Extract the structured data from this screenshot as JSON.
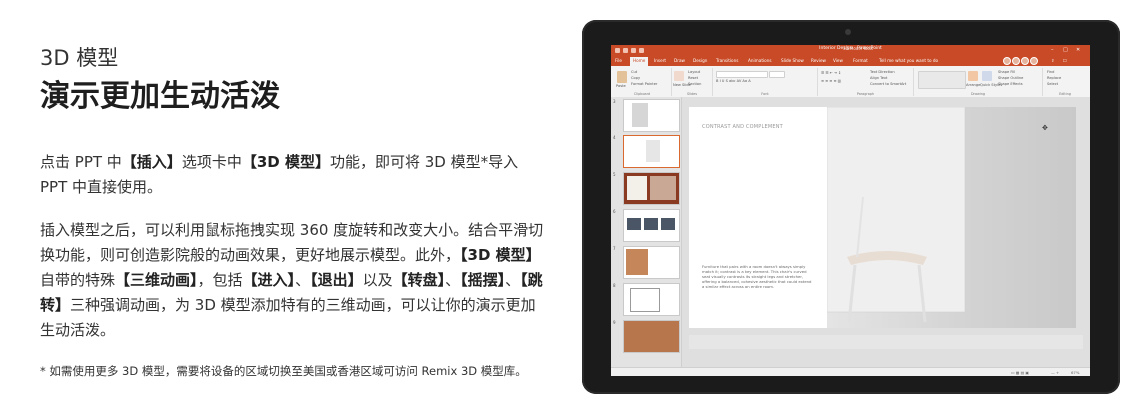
{
  "left": {
    "eyebrow": "3D 模型",
    "headline": "演示更加生动活泼",
    "p1": {
      "t1": "点击 PPT 中",
      "b1": "【插入】",
      "t2": "选项卡中",
      "b2": "【3D 模型】",
      "t3": "功能，即可将 3D 模型*导入 PPT 中直接使用。"
    },
    "p2": {
      "t1": "插入模型之后，可以利用鼠标拖拽实现 360 度旋转和改变大小。结合平滑切换功能，则可创造影院般的动画效果，更好地展示模型。此外，",
      "b1": "【3D 模型】",
      "t2": "自带的特殊",
      "b2": "【三维动画】",
      "t3": "，包括",
      "b3": "【进入】",
      "t4": "、",
      "b4": "【退出】",
      "t5": "以及",
      "b5": "【转盘】",
      "t6": "、",
      "b6": "【摇摆】",
      "t7": "、",
      "b7": "【跳转】",
      "t8": "三种强调动画，为 3D 模型添加特有的三维动画，可以让你的演示更加生动活泼。"
    },
    "footnote": "* 如需使用更多 3D 模型，需要将设备的区域切换至美国或香港区域可访问 Remix 3D 模型库。"
  },
  "device": {
    "window_title": "Interior Design - PowerPoint",
    "context_tab": "3D Model Tools",
    "tabs": [
      "File",
      "Home",
      "Insert",
      "Draw",
      "Design",
      "Transitions",
      "Animations",
      "Slide Show",
      "Review",
      "View",
      "Format"
    ],
    "active_tab": "Home",
    "tell_me": "Tell me what you want to do",
    "ribbon": {
      "clipboard": "Clipboard",
      "slides": "Slides",
      "font": "Font",
      "paragraph": "Paragraph",
      "drawing": "Drawing",
      "editing": "Editing",
      "paste": "Paste",
      "cut": "Cut",
      "copy": "Copy",
      "format_painter": "Format Painter",
      "new_slide": "New Slide",
      "layout": "Layout",
      "reset": "Reset",
      "section": "Section",
      "text_direction": "Text Direction",
      "align_text": "Align Text",
      "convert_smartart": "Convert to SmartArt",
      "arrange": "Arrange",
      "quick_styles": "Quick Styles",
      "shape_fill": "Shape Fill",
      "shape_outline": "Shape Outline",
      "shape_effects": "Shape Effects",
      "find": "Find",
      "replace": "Replace",
      "select": "Select"
    },
    "slide_numbers": [
      "3",
      "4",
      "5",
      "6",
      "7",
      "8",
      "9"
    ],
    "slide": {
      "heading": "CONTRAST AND COMPLEMENT",
      "body": "Furniture that pairs with a room doesn't always simply match it; contrast is a key element. This chair's curved seat visually contrasts its straight legs and stretcher, offering a balanced, cohesive aesthetic that could extend a similar effect across an entire room."
    },
    "status": {
      "zoom": "67%"
    }
  }
}
